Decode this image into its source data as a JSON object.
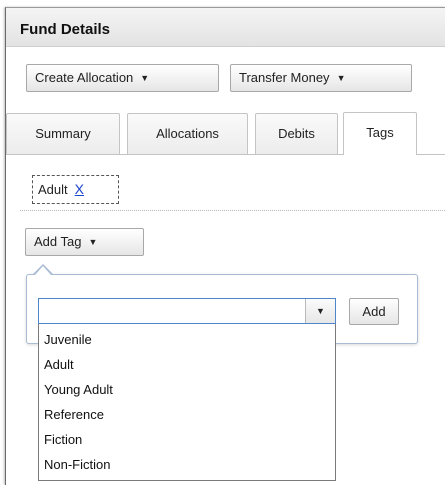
{
  "panel": {
    "title": "Fund Details"
  },
  "toolbar": {
    "create_allocation": "Create Allocation",
    "transfer_money": "Transfer Money"
  },
  "tabs": [
    {
      "label": "Summary",
      "active": false
    },
    {
      "label": "Allocations",
      "active": false
    },
    {
      "label": "Debits",
      "active": false
    },
    {
      "label": "Tags",
      "active": true
    }
  ],
  "tags": [
    {
      "label": "Adult",
      "remove": "X"
    }
  ],
  "add_tag": {
    "button_label": "Add Tag",
    "select_value": "",
    "add_label": "Add",
    "options": [
      "Juvenile",
      "Adult",
      "Young Adult",
      "Reference",
      "Fiction",
      "Non-Fiction"
    ]
  },
  "colors": {
    "link": "#1a44cc",
    "focus_border": "#4f86c9",
    "popup_border": "#a9bcd4"
  }
}
